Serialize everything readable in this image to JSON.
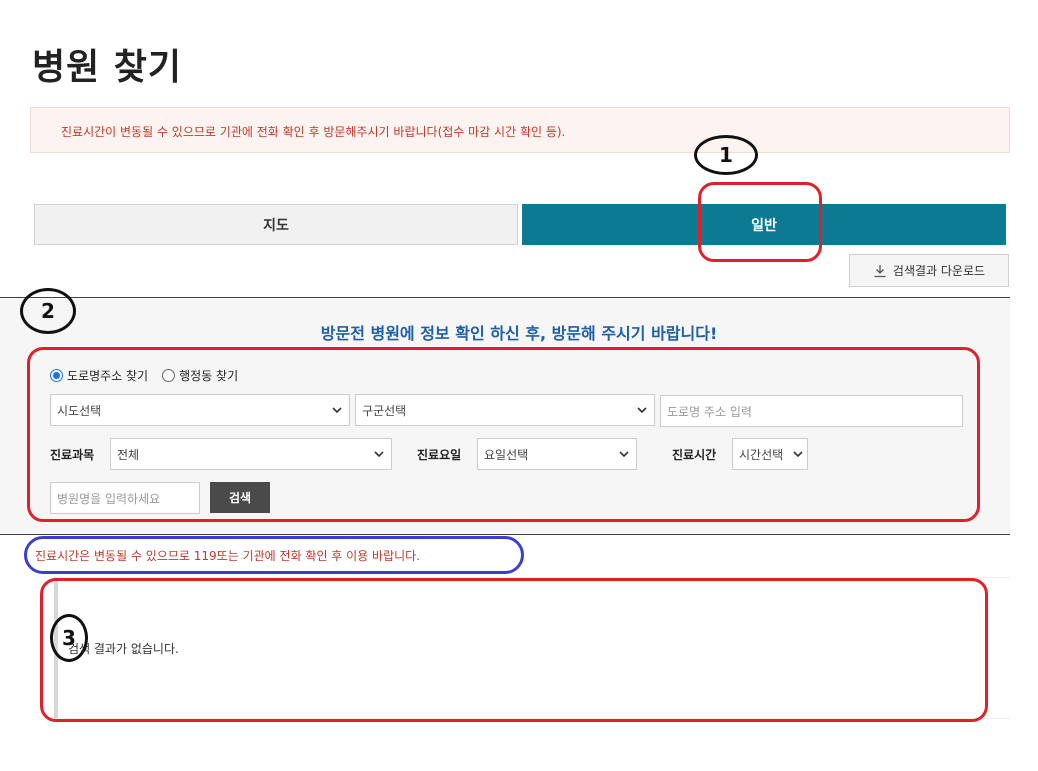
{
  "page": {
    "title": "병원 찾기"
  },
  "notice": {
    "text": "진료시간이 변동될 수 있으므로 기관에 전화 확인 후 방문해주시기 바랍니다(접수 마감 시간 확인 등)."
  },
  "tabs": [
    {
      "label": "지도",
      "active": false
    },
    {
      "label": "일반",
      "active": true
    }
  ],
  "download": {
    "label": "검색결과 다운로드",
    "icon": "download-icon"
  },
  "search": {
    "heading": "방문전 병원에 정보 확인 하신 후, 방문해 주시기 바랍니다!",
    "radio_road": "도로명주소 찾기",
    "radio_admin": "행정동 찾기",
    "radio_selected": "도로명주소 찾기",
    "sido": "시도선택",
    "gugun": "구군선택",
    "road_placeholder": "도로명 주소 입력",
    "dept_label": "진료과목",
    "dept_value": "전체",
    "day_label": "진료요일",
    "day_value": "요일선택",
    "time_label": "진료시간",
    "time_value": "시간선택",
    "name_placeholder": "병원명을 입력하세요",
    "button": "검색"
  },
  "warning": {
    "text": "진료시간은 변동될 수 있으므로 119또는 기관에 전화 확인 후 이용 바랍니다."
  },
  "results": {
    "empty_text": "검색 결과가 없습니다."
  },
  "annotations": {
    "one": "1",
    "two": "2",
    "three": "3"
  },
  "colors": {
    "accent": "#0b7a92",
    "heading": "#1f5fa8",
    "warning": "#c0392b",
    "annotation_red": "#e0202b",
    "annotation_blue": "#3b3ed0"
  }
}
